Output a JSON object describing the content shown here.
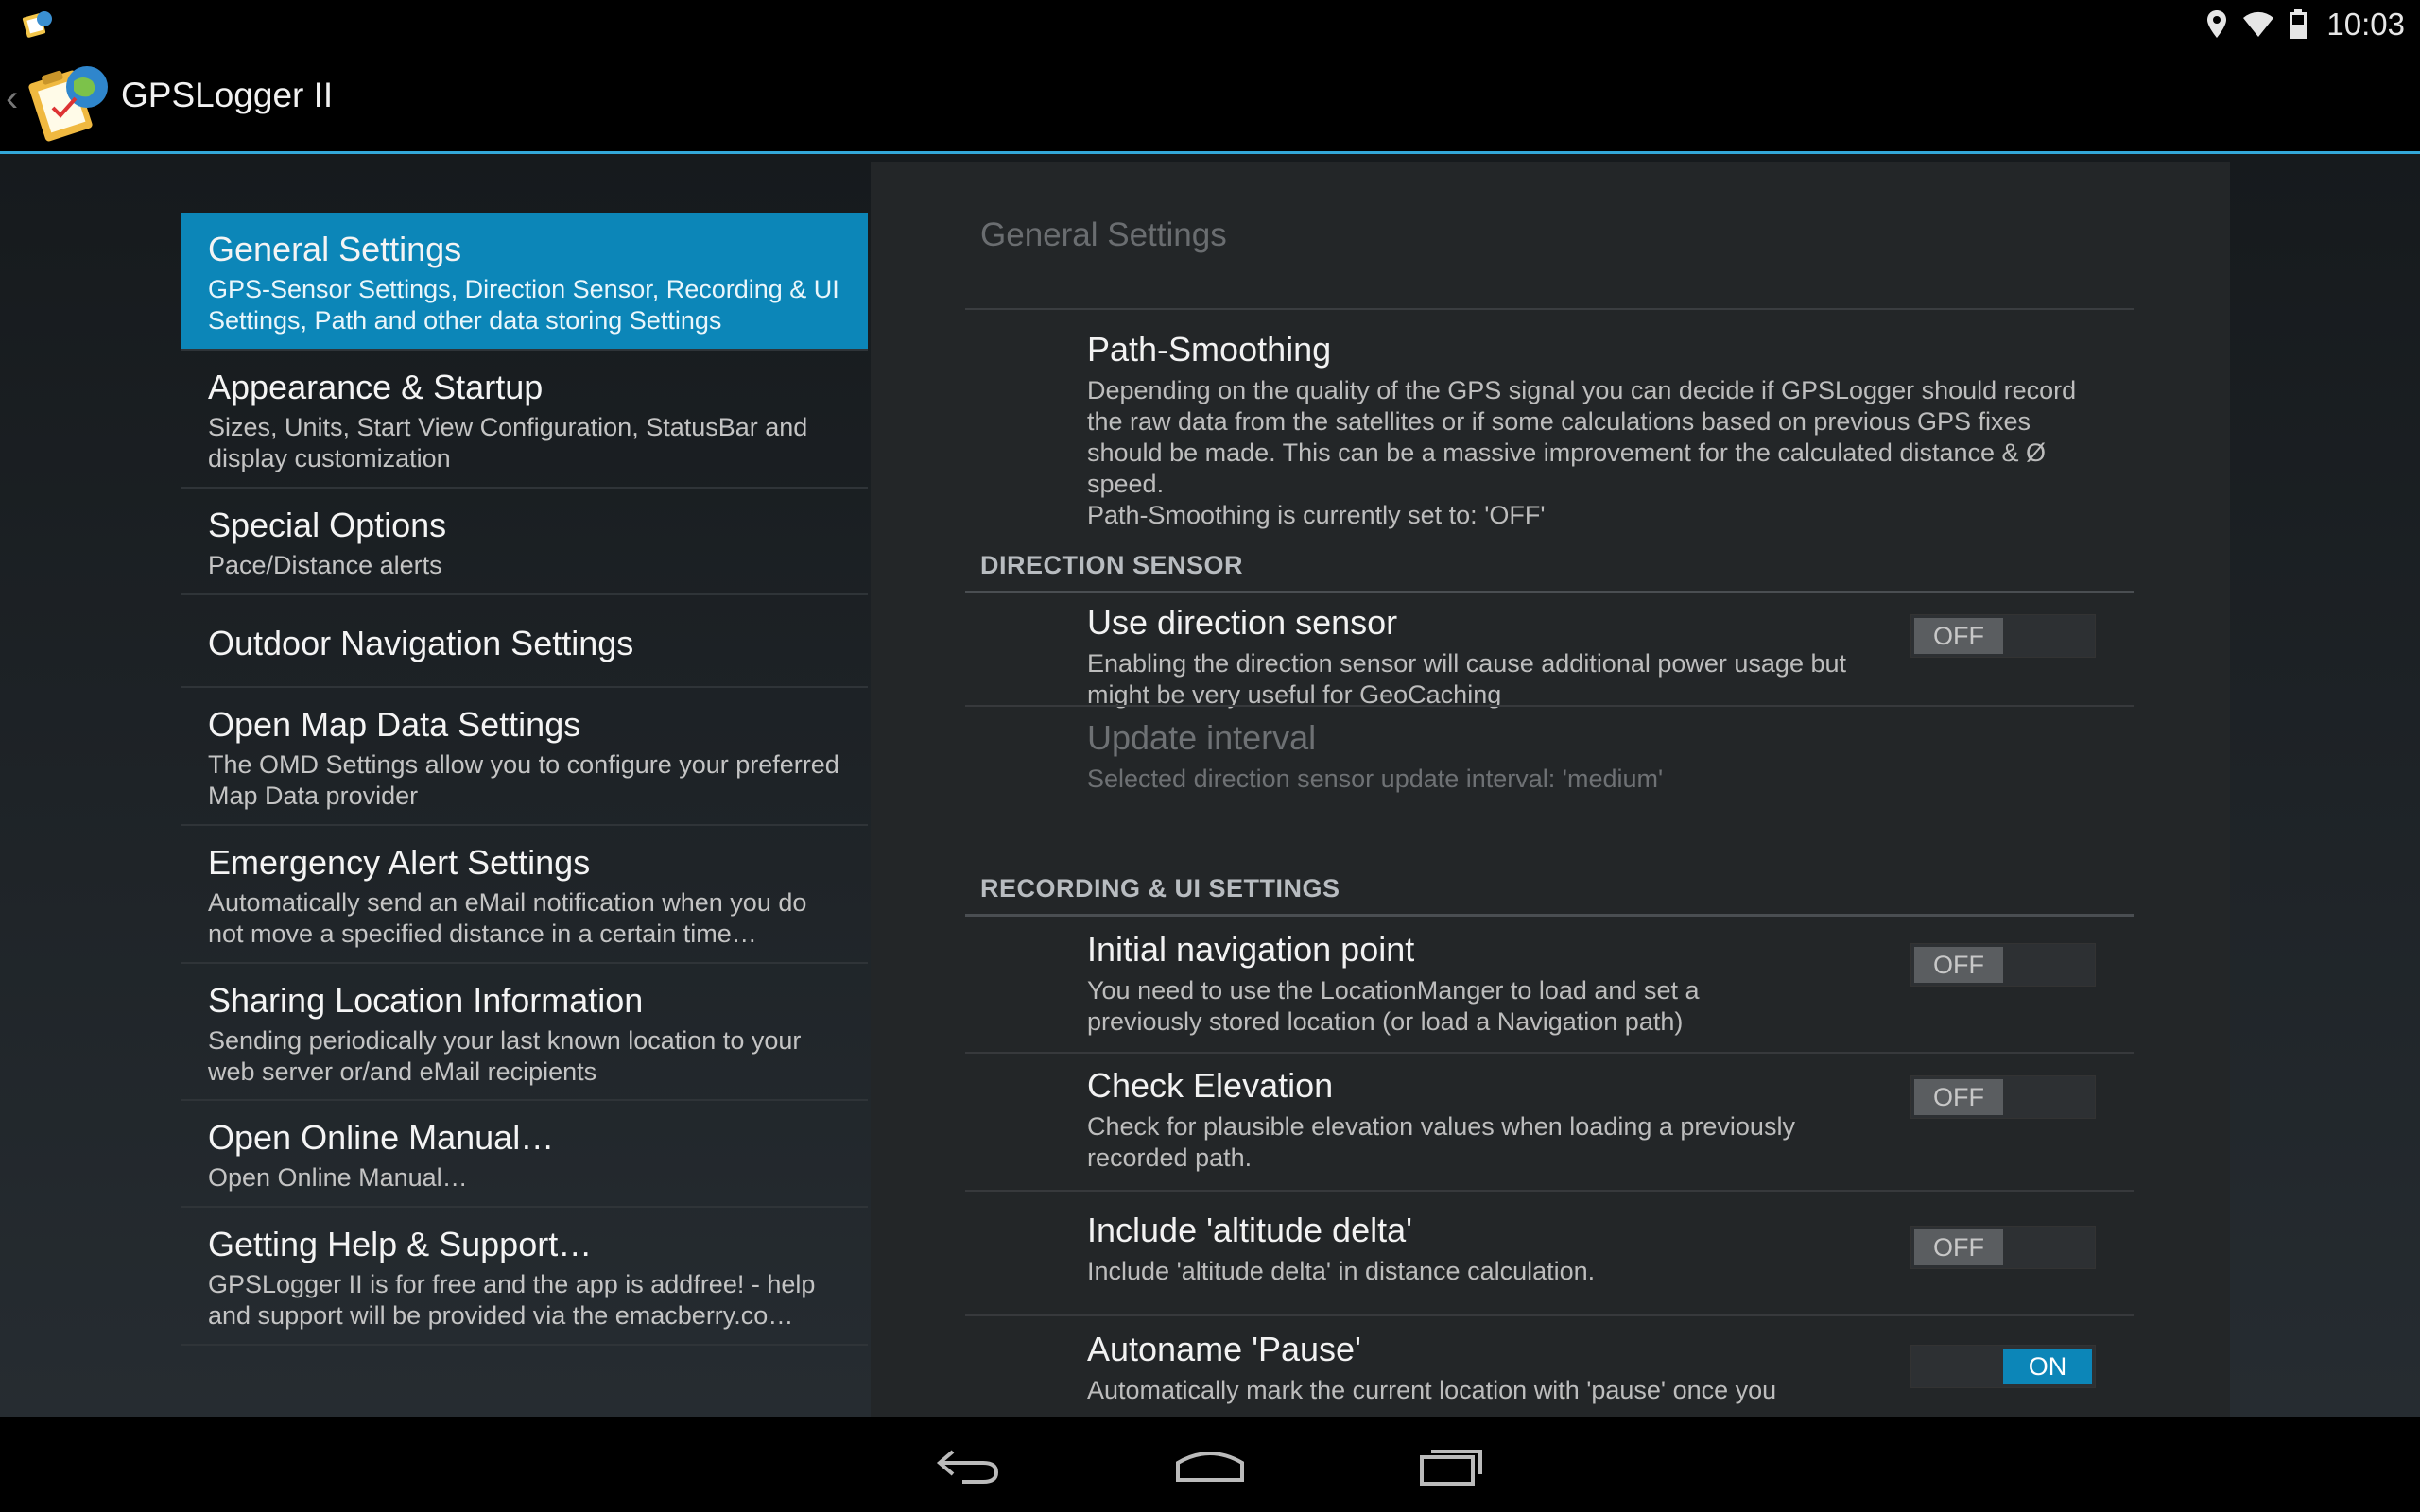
{
  "status": {
    "time": "10:03"
  },
  "app": {
    "title": "GPSLogger II"
  },
  "headers": [
    {
      "title": "General Settings",
      "summary": "GPS-Sensor Settings, Direction Sensor, Recording & UI Settings, Path and other data storing Settings"
    },
    {
      "title": "Appearance & Startup",
      "summary": "Sizes, Units, Start View Configuration, StatusBar and display customization"
    },
    {
      "title": "Special Options",
      "summary": "Pace/Distance alerts"
    },
    {
      "title": "Outdoor Navigation Settings",
      "summary": ""
    },
    {
      "title": "Open Map Data Settings",
      "summary": "The OMD Settings allow you to configure your preferred Map Data provider"
    },
    {
      "title": "Emergency Alert Settings",
      "summary": "Automatically send an eMail notification when you do not move a specified distance in a certain time…"
    },
    {
      "title": "Sharing Location Information",
      "summary": "Sending periodically your last known location to your web server or/and eMail recipients"
    },
    {
      "title": "Open Online Manual…",
      "summary": "Open Online Manual…"
    },
    {
      "title": "Getting Help & Support…",
      "summary": "GPSLogger II is for free and the app is addfree! - help and support will be provided via the emacberry.co…"
    }
  ],
  "panel": {
    "title": "General Settings",
    "path_smoothing": {
      "title": "Path-Smoothing",
      "summary": "Depending on the quality of the GPS signal you can decide if GPSLogger should record the raw data from the satellites or if some calculations based on previous GPS fixes should be made. This can be a massive improvement for the calculated distance & Ø speed.",
      "status": "Path-Smoothing is currently set to: 'OFF'"
    },
    "cat_direction": "DIRECTION SENSOR",
    "use_direction": {
      "title": "Use direction sensor",
      "summary": "Enabling the direction sensor will cause additional power usage but might be very useful for GeoCaching",
      "toggle": "OFF"
    },
    "update_interval": {
      "title": "Update interval",
      "summary": "Selected direction sensor update interval: 'medium'"
    },
    "cat_recording": "RECORDING & UI SETTINGS",
    "initial_nav": {
      "title": "Initial navigation point",
      "summary": "You need to use the LocationManger to load and set a previously stored location (or load a Navigation path)",
      "toggle": "OFF"
    },
    "check_elev": {
      "title": "Check Elevation",
      "summary": "Check for plausible elevation values when loading a previously recorded path.",
      "toggle": "OFF"
    },
    "alt_delta": {
      "title": "Include 'altitude delta'",
      "summary": "Include 'altitude delta' in distance calculation.",
      "toggle": "OFF"
    },
    "autoname": {
      "title": "Autoname 'Pause'",
      "summary": "Automatically mark the current location with 'pause' once you",
      "toggle": "ON"
    }
  },
  "colors": {
    "accent": "#0c86b8",
    "actionbar_line": "#33a7d8"
  }
}
